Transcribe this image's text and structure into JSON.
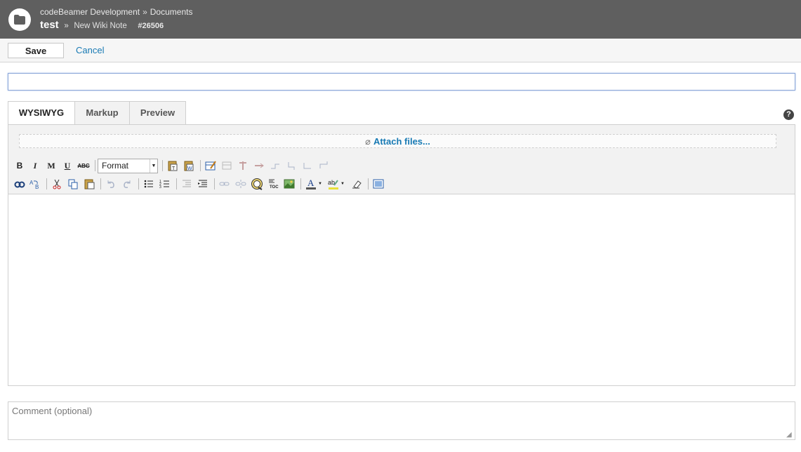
{
  "header": {
    "breadcrumb": [
      "codeBeamer Development",
      "Documents"
    ],
    "breadcrumb_sep": "»",
    "title": "test",
    "sub_sep": "»",
    "subtitle": "New Wiki Note",
    "item_id": "#26506"
  },
  "actions": {
    "save_label": "Save",
    "cancel_label": "Cancel"
  },
  "title_input": {
    "value": "",
    "placeholder": ""
  },
  "tabs": [
    {
      "label": "WYSIWYG",
      "active": true
    },
    {
      "label": "Markup",
      "active": false
    },
    {
      "label": "Preview",
      "active": false
    }
  ],
  "help": {
    "glyph": "?"
  },
  "attach": {
    "label": "Attach files...",
    "icon": "paperclip-icon"
  },
  "toolbar": {
    "bold": "B",
    "italic": "I",
    "monospace": "M",
    "underline": "U",
    "strike": "ABC",
    "format_label": "Format",
    "toc": "TOC"
  },
  "comment": {
    "placeholder": "Comment (optional)",
    "value": ""
  },
  "colors": {
    "header_bg": "#5f5f5f",
    "link": "#187ab4",
    "panel_bg": "#f2f2f2"
  }
}
